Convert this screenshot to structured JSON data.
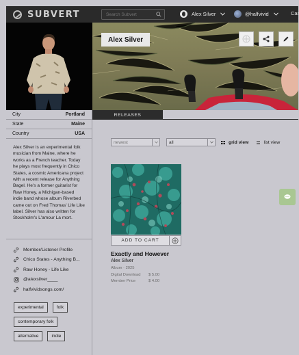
{
  "topbar": {
    "logo_text": "SUBVERT",
    "search_placeholder": "Search Subvert",
    "artist_menu": "Alex Silver",
    "account_menu": "@halfvivid",
    "cart": "Cart"
  },
  "profile": {
    "name": "Alex Silver",
    "info": [
      {
        "label": "City",
        "value": "Portland"
      },
      {
        "label": "State",
        "value": "Maine"
      },
      {
        "label": "Country",
        "value": "USA"
      }
    ],
    "bio": "Alex Silver is an experimental folk musician from Maine, where he works as a French teacher. Today he plays most frequently in Chico States, a cosmic Americana project with a recent release for Anything Bagel. He's a former guitarist for Raw Honey, a Michigan-based indie band whose album Riverbed came out on Fred Thomas' Life Like label. Silver has also written for Stockholm's L'amour La mort.",
    "links": [
      {
        "icon": "link-icon",
        "label": "Member/Listener Profile"
      },
      {
        "icon": "link-icon",
        "label": "Chico States - Anything B..."
      },
      {
        "icon": "link-icon",
        "label": "Raw Honey - Life Like"
      },
      {
        "icon": "instagram-icon",
        "label": "@alexsilver____"
      },
      {
        "icon": "link-icon",
        "label": "halfvividsongs.com/"
      }
    ],
    "tags": [
      [
        "experimental",
        "folk"
      ],
      [
        "contemporary folk"
      ],
      [
        "alternative",
        "indie"
      ]
    ]
  },
  "tabs": {
    "releases": "RELEASES"
  },
  "filters": {
    "sort": "newest",
    "type": "all",
    "grid_view": "grid view",
    "list_view": "list view"
  },
  "release": {
    "title": "Exactly and However",
    "artist": "Alex Silver",
    "meta": "Album · 2025",
    "prices": [
      {
        "label": "Digital Download",
        "value": "$ 5.00"
      },
      {
        "label": "Member Price",
        "value": "$ 4.00"
      }
    ],
    "add_to_cart": "ADD TO CART"
  },
  "colors": {
    "background": "#c9c8cf",
    "topbar": "#2a2a2a",
    "chat_button": "#a9c792"
  }
}
